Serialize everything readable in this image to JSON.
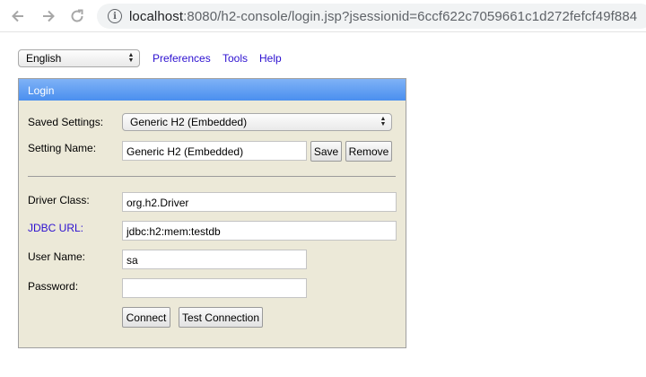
{
  "browser": {
    "url_host": "localhost",
    "url_rest": ":8080/h2-console/login.jsp?jsessionid=6ccf622c7059661c1d272fefcf49f884"
  },
  "toolbar": {
    "language": "English",
    "preferences": "Preferences",
    "tools": "Tools",
    "help": "Help"
  },
  "login": {
    "title": "Login",
    "saved_settings_label": "Saved Settings:",
    "saved_settings_value": "Generic H2 (Embedded)",
    "setting_name_label": "Setting Name:",
    "setting_name_value": "Generic H2 (Embedded)",
    "save_label": "Save",
    "remove_label": "Remove",
    "driver_class_label": "Driver Class:",
    "driver_class_value": "org.h2.Driver",
    "jdbc_url_label": "JDBC URL:",
    "jdbc_url_value": "jdbc:h2:mem:testdb",
    "user_name_label": "User Name:",
    "user_name_value": "sa",
    "password_label": "Password:",
    "password_value": "",
    "connect_label": "Connect",
    "test_connection_label": "Test Connection"
  }
}
